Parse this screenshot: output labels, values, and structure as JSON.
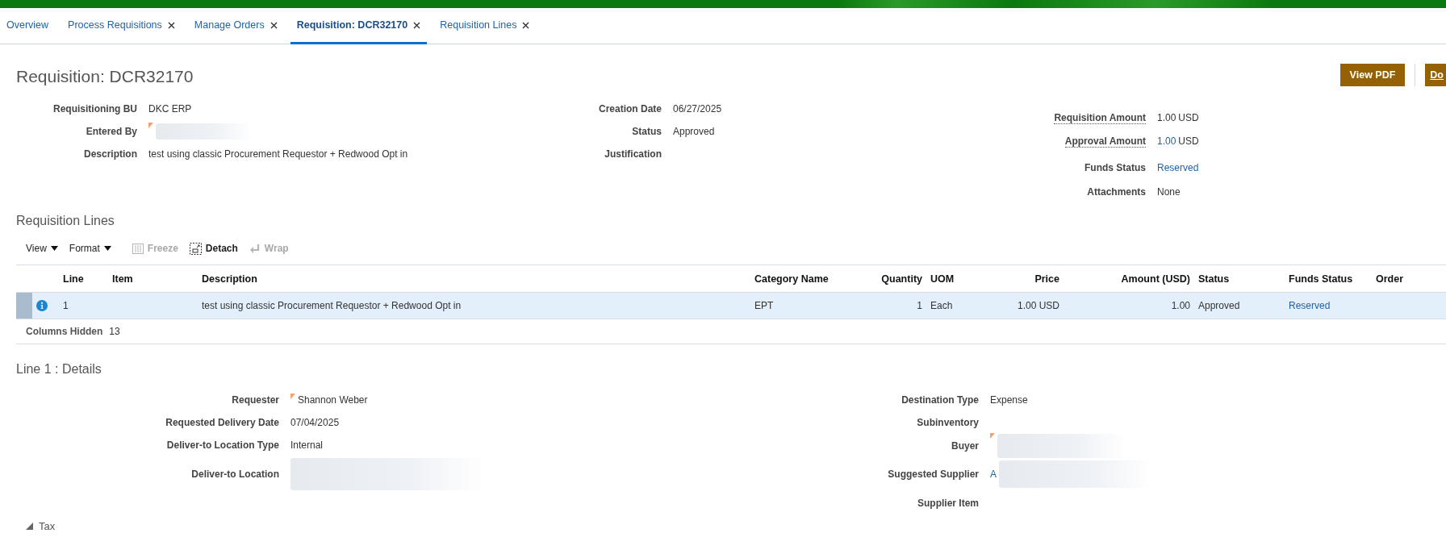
{
  "tabs": [
    {
      "label": "Overview",
      "closable": false,
      "selected": false
    },
    {
      "label": "Process Requisitions",
      "closable": true,
      "selected": false
    },
    {
      "label": "Manage Orders",
      "closable": true,
      "selected": false
    },
    {
      "label": "Requisition: DCR32170",
      "closable": true,
      "selected": true
    },
    {
      "label": "Requisition Lines",
      "closable": true,
      "selected": false
    }
  ],
  "page": {
    "title": "Requisition: DCR32170",
    "buttons": [
      "View PDF",
      "Do"
    ]
  },
  "header_fields": [
    [
      {
        "label": "Requisitioning BU",
        "kind": "text",
        "value": "DKC ERP"
      },
      {
        "label": "Entered By",
        "kind": "person",
        "redacted": true
      },
      {
        "label": "Description",
        "kind": "text",
        "value": "test using classic Procurement Requestor + Redwood Opt in"
      }
    ],
    [
      {
        "label": "Creation Date",
        "kind": "text",
        "value": "06/27/2025"
      },
      {
        "label": "Status",
        "kind": "text",
        "value": "Approved"
      },
      {
        "label": "Justification",
        "kind": "text"
      }
    ],
    [
      {
        "label": "Requisition Amount",
        "kind": "amount",
        "help": true,
        "amount": "1.00",
        "currency": "USD",
        "linked": false
      },
      {
        "label": "Approval Amount",
        "kind": "amount",
        "help": true,
        "amount": "1.00",
        "currency": "USD",
        "linked": true
      },
      {
        "label": "Funds Status",
        "kind": "link",
        "value": "Reserved"
      },
      {
        "label": "Attachments",
        "kind": "text",
        "value": "None"
      }
    ]
  ],
  "lines": {
    "title": "Requisition Lines",
    "toolbar": [
      {
        "label": "View",
        "kind": "menu",
        "disabled": false
      },
      {
        "label": "Format",
        "kind": "menu",
        "disabled": false
      },
      {
        "label": "Freeze",
        "kind": "freeze",
        "disabled": true
      },
      {
        "label": "Detach",
        "kind": "detach",
        "disabled": false
      },
      {
        "label": "Wrap",
        "kind": "wrap",
        "disabled": true
      }
    ],
    "columns": [
      {
        "label": "Line",
        "kind": "text"
      },
      {
        "label": "Item",
        "kind": "text"
      },
      {
        "label": "Description",
        "kind": "text"
      },
      {
        "label": "Category Name",
        "kind": "text"
      },
      {
        "label": "Quantity",
        "kind": "number"
      },
      {
        "label": "UOM",
        "kind": "text"
      },
      {
        "label": "Price",
        "kind": "number"
      },
      {
        "label": "Amount (USD)",
        "kind": "number"
      },
      {
        "label": "Status",
        "kind": "text"
      },
      {
        "label": "Funds Status",
        "kind": "link"
      },
      {
        "label": "Order",
        "kind": "text"
      }
    ],
    "rows": [
      {
        "selected": true,
        "info": true,
        "cells": [
          "1",
          "",
          "test using classic Procurement Requestor + Redwood Opt in",
          "EPT",
          "1",
          "Each",
          "1.00 USD",
          "1.00",
          "Approved",
          "Reserved"
        ]
      }
    ],
    "columns_hidden": {
      "label": "Columns Hidden",
      "count": "13"
    }
  },
  "details": {
    "title": "Line 1 : Details",
    "columns": [
      [
        {
          "label": "Requester",
          "kind": "person",
          "value": "Shannon Weber"
        },
        {
          "label": "Requested Delivery Date",
          "kind": "text",
          "value": "07/04/2025"
        },
        {
          "label": "Deliver-to Location Type",
          "kind": "text",
          "value": "Internal"
        },
        {
          "label": "Deliver-to Location",
          "kind": "text",
          "redacted": true
        }
      ],
      [
        {
          "label": "Destination Type",
          "kind": "text",
          "value": "Expense"
        },
        {
          "label": "Subinventory",
          "kind": "text"
        },
        {
          "label": "Buyer",
          "kind": "person",
          "redacted": true
        },
        {
          "label": "Suggested Supplier",
          "kind": "link",
          "value": "A",
          "redacted": true
        },
        {
          "label": "Supplier Item",
          "kind": "text"
        }
      ]
    ]
  },
  "tax": {
    "label": "Tax",
    "expanded": true
  }
}
